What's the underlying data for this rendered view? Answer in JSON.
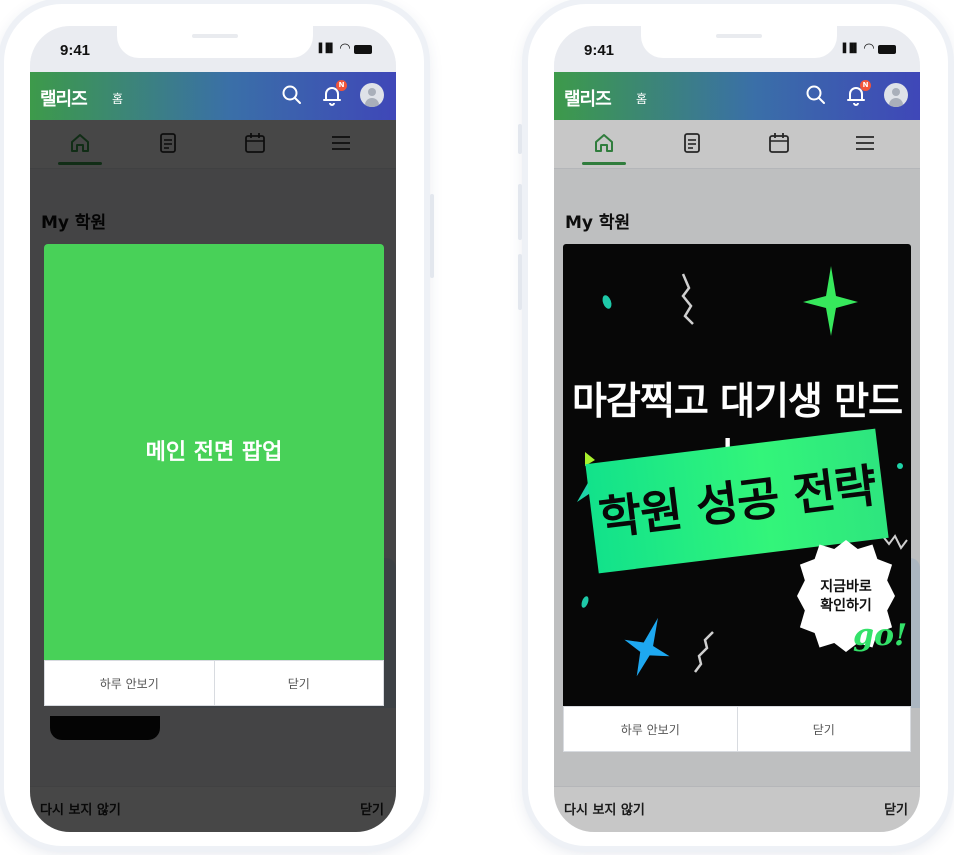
{
  "status_bar": {
    "time": "9:41",
    "signal": "▐▐▌",
    "wifi": "◠"
  },
  "header": {
    "brand": "랠리즈",
    "page": "홈",
    "notification_badge": "N"
  },
  "tabs": [
    {
      "name": "home",
      "active": true
    },
    {
      "name": "document"
    },
    {
      "name": "calendar"
    },
    {
      "name": "menu"
    }
  ],
  "section": {
    "title": "My 학원"
  },
  "bottom_bar": {
    "left_label": "다시 보지 않기",
    "right_label": "닫기"
  },
  "popup_placeholder": {
    "text": "메인 전면 팝업",
    "hide_today_label": "하루 안보기",
    "close_label": "닫기"
  },
  "popup_banner": {
    "line1": "마감찍고 대기생 만드는",
    "line2": "학원 성공 전략",
    "burst_line1": "지금바로",
    "burst_line2": "확인하기",
    "go": "go!",
    "hide_today_label": "하루 안보기",
    "close_label": "닫기"
  },
  "colors": {
    "accent_green": "#48d158",
    "header_gradient_start": "#3d9a4a",
    "header_gradient_end": "#3f47b8",
    "banner_band": "#33f57a",
    "badge": "#f2553a"
  }
}
